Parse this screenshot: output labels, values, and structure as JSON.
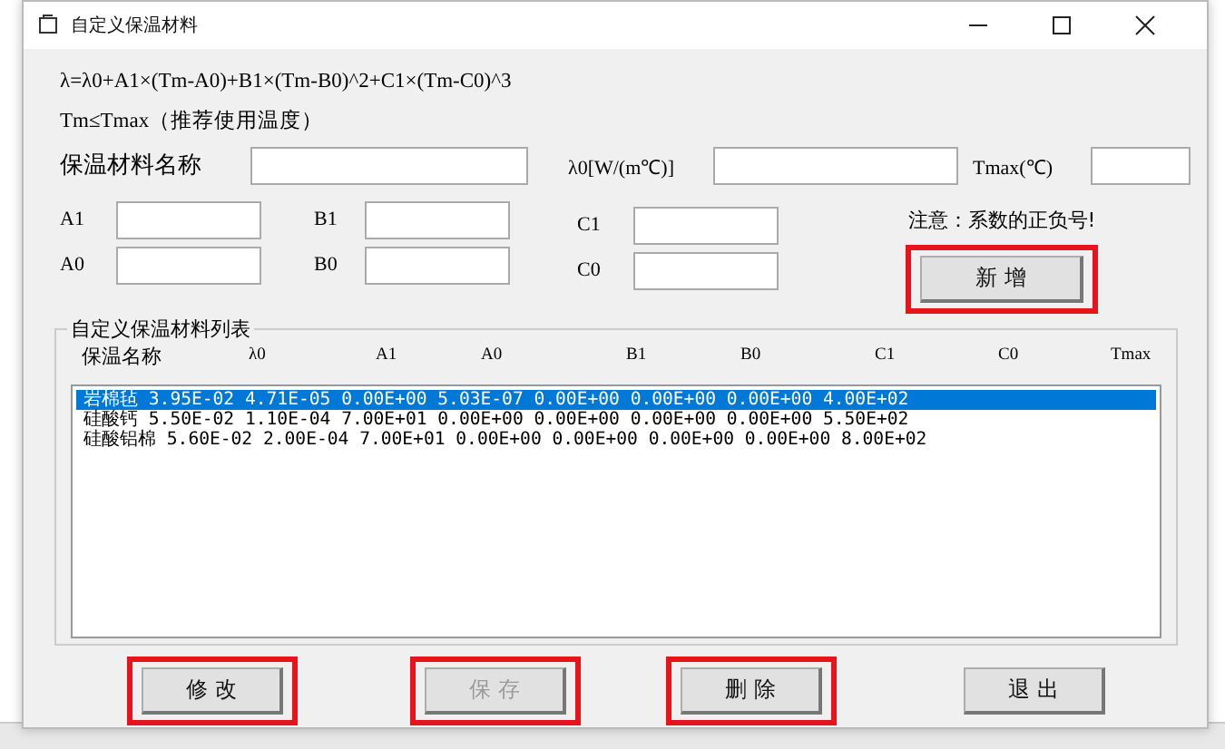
{
  "window": {
    "title": "自定义保温材料"
  },
  "formula": "λ=λ0+A1×(Tm-A0)+B1×(Tm-B0)^2+C1×(Tm-C0)^3",
  "condition": "Tm≤Tmax（推荐使用温度）",
  "fields": {
    "name_label": "保温材料名称",
    "lambda_label": "λ0[W/(m℃)]",
    "tmax_label": "Tmax(℃)",
    "a1_label": "A1",
    "a0_label": "A0",
    "b1_label": "B1",
    "b0_label": "B0",
    "c1_label": "C1",
    "c0_label": "C0"
  },
  "note": "注意：系数的正负号!",
  "add_button": {
    "label": "新  增",
    "highlighted": true
  },
  "list": {
    "title": "自定义保温材料列表",
    "columns": [
      "保温名称",
      "λ0",
      "A1",
      "A0",
      "B1",
      "B0",
      "C1",
      "C0",
      "Tmax"
    ],
    "rows": [
      {
        "text": "岩棉毡  3.95E-02  4.71E-05  0.00E+00  5.03E-07  0.00E+00  0.00E+00  0.00E+00  4.00E+02",
        "selected": true
      },
      {
        "text": "硅酸钙  5.50E-02  1.10E-04  7.00E+01  0.00E+00  0.00E+00  0.00E+00  0.00E+00  5.50E+02",
        "selected": false
      },
      {
        "text": "硅酸铝棉  5.60E-02  2.00E-04  7.00E+01  0.00E+00  0.00E+00  0.00E+00  0.00E+00  8.00E+02",
        "selected": false
      }
    ]
  },
  "buttons": [
    {
      "label": "修  改",
      "disabled": false,
      "highlighted": true
    },
    {
      "label": "保  存",
      "disabled": true,
      "highlighted": true
    },
    {
      "label": "删  除",
      "disabled": false,
      "highlighted": true
    },
    {
      "label": "退  出",
      "disabled": false,
      "highlighted": false
    }
  ]
}
